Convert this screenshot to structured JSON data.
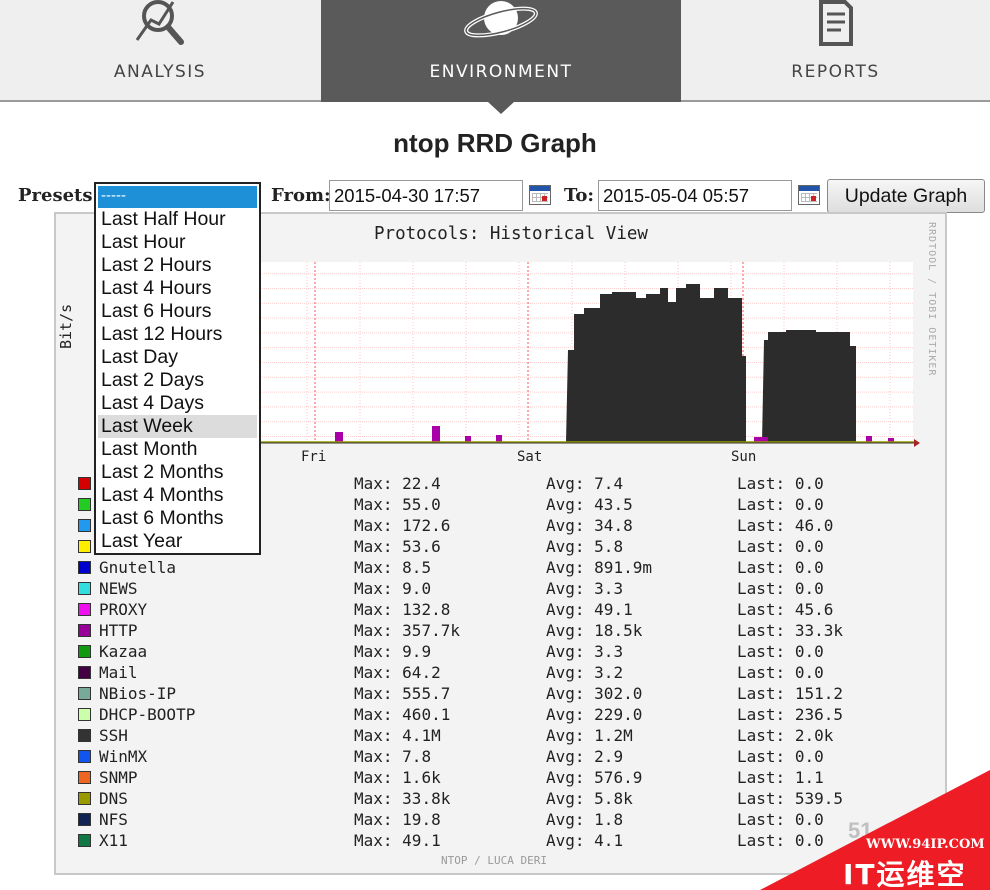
{
  "nav": {
    "tabs": [
      {
        "label": "ANALYSIS",
        "icon": "magnifier-chart-icon"
      },
      {
        "label": "ENVIRONMENT",
        "icon": "planet-icon",
        "active": true
      },
      {
        "label": "REPORTS",
        "icon": "document-icon"
      }
    ]
  },
  "page_title": "ntop RRD Graph",
  "controls": {
    "presets_label": "Presets:",
    "presets_selected": "-----",
    "presets_options": [
      "Last Half Hour",
      "Last Hour",
      "Last 2 Hours",
      "Last 4 Hours",
      "Last 6 Hours",
      "Last 12 Hours",
      "Last Day",
      "Last 2 Days",
      "Last 4 Days",
      "Last Week",
      "Last Month",
      "Last 2 Months",
      "Last 4 Months",
      "Last 6 Months",
      "Last Year"
    ],
    "presets_highlighted": "Last Week",
    "from_label": "From:",
    "from_value": "2015-04-30 17:57",
    "to_label": "To:",
    "to_value": "2015-05-04 05:57",
    "update_label": "Update Graph"
  },
  "graph": {
    "title": "Protocols: Historical View",
    "ylabel": "Bit/s",
    "side_credit": "RRDTOOL / TOBI OETIKER",
    "footer_credit": "NTOP / LUCA DERI",
    "partial_number": "51",
    "legend": [
      {
        "name": "",
        "color": "#d40000",
        "max": "22.4",
        "avg": "7.4",
        "last": "0.0"
      },
      {
        "name": "",
        "color": "#22cc22",
        "max": "55.0",
        "avg": "43.5",
        "last": "0.0"
      },
      {
        "name": "",
        "color": "#2299ee",
        "max": "172.6",
        "avg": "34.8",
        "last": "46.0"
      },
      {
        "name": "",
        "color": "#ffee00",
        "max": "53.6",
        "avg": "5.8",
        "last": "0.0"
      },
      {
        "name": "Gnutella",
        "color": "#0000cc",
        "max": "8.5",
        "avg": "891.9m",
        "last": "0.0"
      },
      {
        "name": "NEWS",
        "color": "#33dddd",
        "max": "9.0",
        "avg": "3.3",
        "last": "0.0"
      },
      {
        "name": "PROXY",
        "color": "#ee11ee",
        "max": "132.8",
        "avg": "49.1",
        "last": "45.6"
      },
      {
        "name": "HTTP",
        "color": "#990099",
        "max": "357.7k",
        "avg": "18.5k",
        "last": "33.3k"
      },
      {
        "name": "Kazaa",
        "color": "#119911",
        "max": "9.9",
        "avg": "3.3",
        "last": "0.0"
      },
      {
        "name": "Mail",
        "color": "#440044",
        "max": "64.2",
        "avg": "3.2",
        "last": "0.0"
      },
      {
        "name": "NBios-IP",
        "color": "#77aa99",
        "max": "555.7",
        "avg": "302.0",
        "last": "151.2"
      },
      {
        "name": "DHCP-BOOTP",
        "color": "#ccffaa",
        "max": "460.1",
        "avg": "229.0",
        "last": "236.5"
      },
      {
        "name": "SSH",
        "color": "#333333",
        "max": "4.1M",
        "avg": "1.2M",
        "last": "2.0k"
      },
      {
        "name": "WinMX",
        "color": "#1155ee",
        "max": "7.8",
        "avg": "2.9",
        "last": "0.0"
      },
      {
        "name": "SNMP",
        "color": "#ee6622",
        "max": "1.6k",
        "avg": "576.9",
        "last": "1.1"
      },
      {
        "name": "DNS",
        "color": "#999900",
        "max": "33.8k",
        "avg": "5.8k",
        "last": "539.5"
      },
      {
        "name": "NFS",
        "color": "#112255",
        "max": "19.8",
        "avg": "1.8",
        "last": "0.0"
      },
      {
        "name": "X11",
        "color": "#117744",
        "max": "49.1",
        "avg": "4.1",
        "last": "0.0"
      }
    ],
    "row_labels": {
      "max": "Max:",
      "avg": "Avg:",
      "last": "Last:"
    },
    "x_ticks": [
      "Fri",
      "Sat",
      "Sun"
    ]
  },
  "badge": {
    "url": "WWW.94IP.COM",
    "name": "IT运维空间",
    "color": "#ee1c24"
  }
}
